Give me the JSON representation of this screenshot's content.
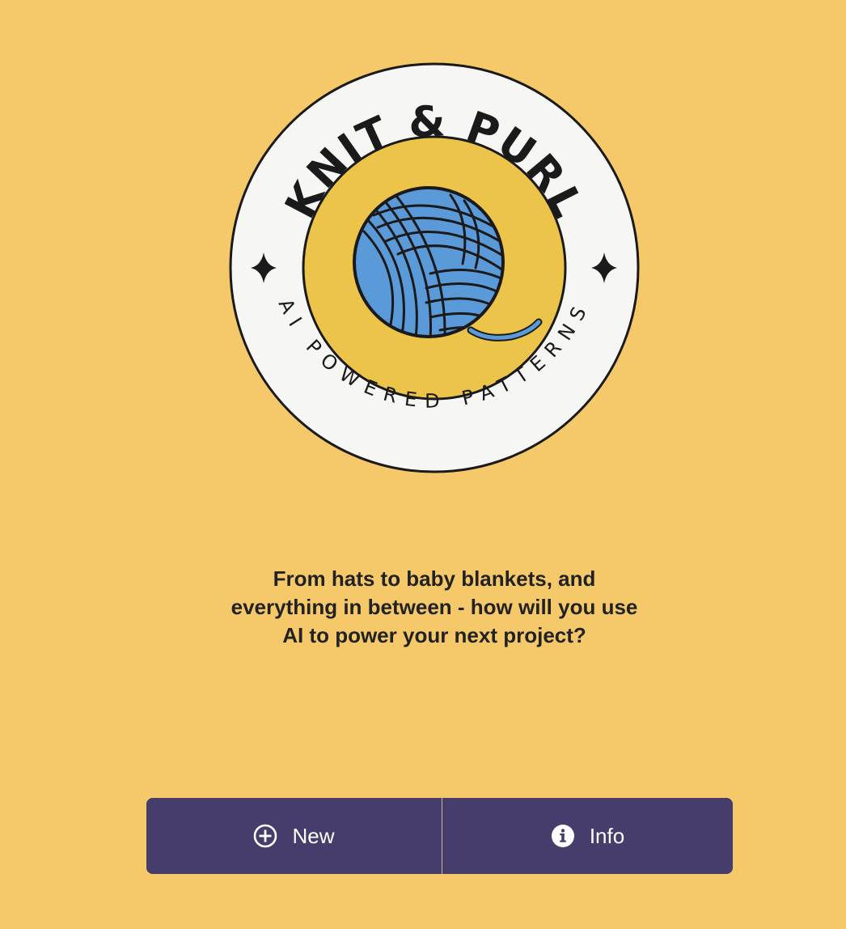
{
  "logo": {
    "title": "KNIT & PURL",
    "subtitle": "AI POWERED PATTERNS",
    "icon": "yarn-ball-icon",
    "colors": {
      "outer_ring": "#f6f6f4",
      "inner_circle": "#ecc44a",
      "yarn": "#5b9ad8",
      "outline": "#1a1a1a"
    }
  },
  "tagline": "From hats to baby blankets, and everything in between - how will you use AI to power your next project?",
  "actions": {
    "new": {
      "label": "New",
      "icon": "plus-circle-icon"
    },
    "info": {
      "label": "Info",
      "icon": "info-circle-icon"
    }
  },
  "colors": {
    "background": "#f5c86a",
    "button_bar": "#463d6d",
    "button_text": "#ffffff",
    "tagline_text": "#222222"
  }
}
